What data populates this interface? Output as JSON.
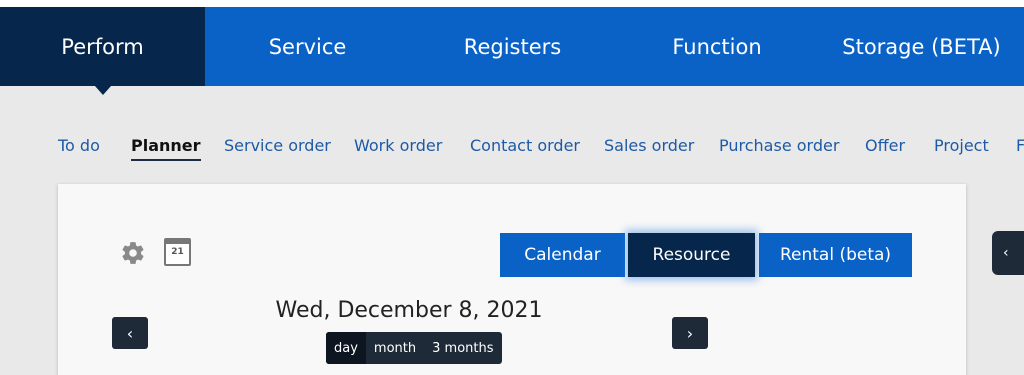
{
  "topnav": {
    "tabs": [
      {
        "label": "Perform",
        "active": true
      },
      {
        "label": "Service",
        "active": false
      },
      {
        "label": "Registers",
        "active": false
      },
      {
        "label": "Function",
        "active": false
      },
      {
        "label": "Storage (BETA)",
        "active": false
      }
    ]
  },
  "subnav": {
    "items": [
      {
        "label": "To do",
        "active": false
      },
      {
        "label": "Planner",
        "active": true
      },
      {
        "label": "Service order",
        "active": false
      },
      {
        "label": "Work order",
        "active": false
      },
      {
        "label": "Contact order",
        "active": false
      },
      {
        "label": "Sales order",
        "active": false
      },
      {
        "label": "Purchase order",
        "active": false
      },
      {
        "label": "Offer",
        "active": false
      },
      {
        "label": "Project",
        "active": false
      },
      {
        "label": "F",
        "active": false
      }
    ]
  },
  "planner": {
    "calendar_icon_day": "21",
    "views": [
      {
        "label": "Calendar",
        "active": false
      },
      {
        "label": "Resource",
        "active": true
      },
      {
        "label": "Rental (beta)",
        "active": false
      }
    ],
    "current_date": "Wed, December 8, 2021",
    "ranges": [
      {
        "label": "day",
        "active": true
      },
      {
        "label": "month",
        "active": false
      },
      {
        "label": "3 months",
        "active": false
      }
    ],
    "prev_glyph": "‹",
    "next_glyph": "›"
  },
  "sidetab_glyph": "‹",
  "icons": {
    "settings": "gear-icon",
    "calendar": "calendar-icon",
    "prev": "chevron-left-icon",
    "next": "chevron-right-icon",
    "collapse": "chevron-left-icon"
  },
  "colors": {
    "nav_blue": "#0a62c6",
    "nav_dark": "#07264b",
    "link": "#1d5aa6",
    "button_dark": "#1f2a39"
  }
}
